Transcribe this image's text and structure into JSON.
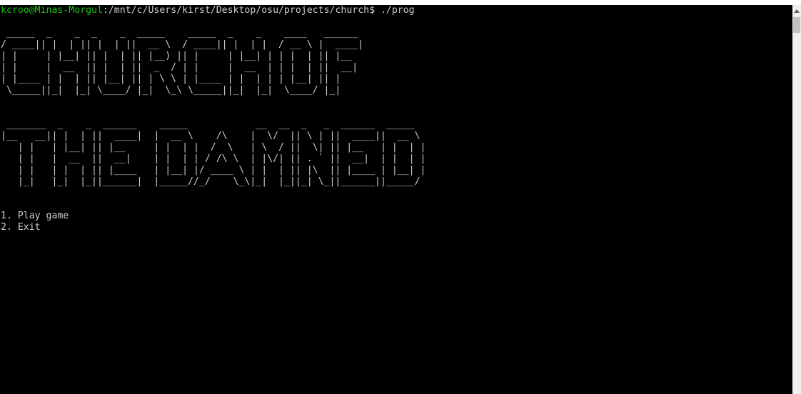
{
  "terminal": {
    "prompt_user_host": "kcroo@Minas-Morgul",
    "prompt_path": ":/mnt/c/Users/kirst/Desktop/osu/projects/church$ ./prog",
    "ascii_art": " _____  _    _  _    _  _____    _____  _    _    ____   ______ \n/ ____|| |  | || |  | ||  __ \\  / ____|| |  | |  / __ \\ |  ____|\n| |     | |__| || |  | || |__) || |     | |__| | | |  | || |__   \n| |     |  __  || |  | ||  _  / | |     |  __  | | |  | ||  __|  \n| |____ | |  | || |__| || | \\ \\ | |____ | |  | | | |__| || |     \n \\_____||_|  |_| \\____/ |_|  \\_\\ \\_____||_|  |_|  \\____/ |_|     \n\n\n _______  _    _  ______    _____            __  __  _   _  ______  _____  \n|__   __|| |  | ||  ____|  |  __ \\    /\\    |  \\/  || \\ | ||  ____||  __ \\ \n   | |   | |__| || |__     | |  | |  /  \\   | \\  / ||  \\| || |__   | |  | |\n   | |   |  __  ||  __|    | |  | | / /\\ \\  | |\\/| || . ` ||  __|  | |  | |\n   | |   | |  | || |____   | |__| |/ ____ \\ | |  | || |\\  || |____ | |__| |\n   |_|   |_|  |_||______|  |_____//_/    \\_\\|_|  |_||_| \\_||______||_____/ ",
    "menu_option_1": "1. Play game",
    "menu_option_2": "2. Exit"
  },
  "colors": {
    "background": "#000000",
    "text": "#cccccc",
    "user_host": "#16c60c",
    "scrollbar_track": "#f0f0f0",
    "scrollbar_thumb": "#c2c2c2"
  }
}
